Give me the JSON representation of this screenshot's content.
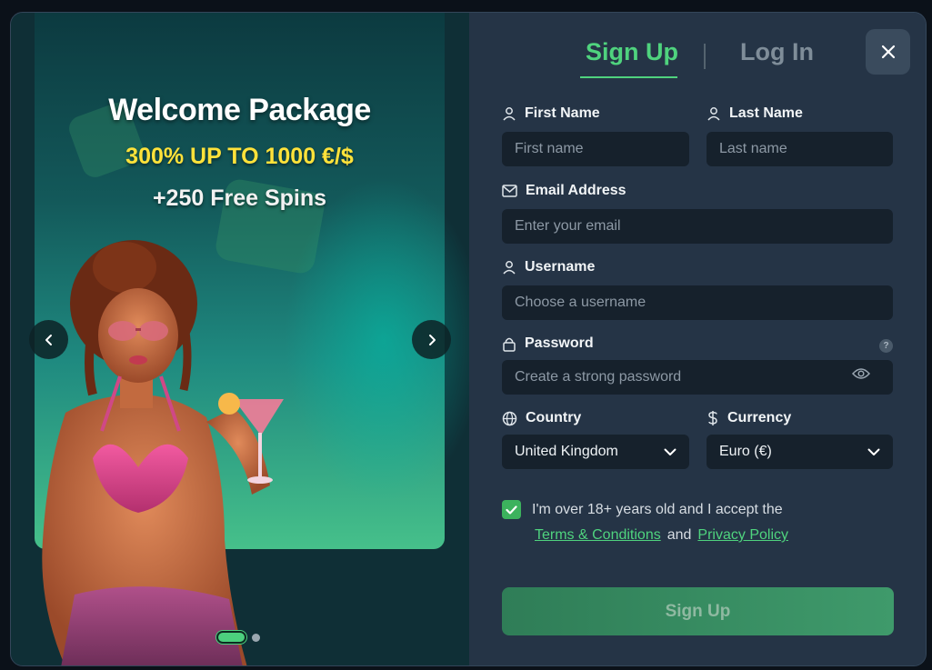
{
  "promo": {
    "title": "Welcome Package",
    "subtitle": "300% UP TO 1000 €/$",
    "spins": "+250 Free Spins",
    "slide_count": 2,
    "active_slide": 1
  },
  "tabs": {
    "signup": "Sign Up",
    "login": "Log In",
    "active": "signup"
  },
  "form": {
    "first_name": {
      "label": "First Name",
      "placeholder": "First name"
    },
    "last_name": {
      "label": "Last Name",
      "placeholder": "Last name"
    },
    "email": {
      "label": "Email Address",
      "placeholder": "Enter your email"
    },
    "username": {
      "label": "Username",
      "placeholder": "Choose a username"
    },
    "password": {
      "label": "Password",
      "placeholder": "Create a strong password",
      "help": "?"
    },
    "country": {
      "label": "Country",
      "value": "United Kingdom"
    },
    "currency": {
      "label": "Currency",
      "value": "Euro (€)"
    },
    "age_check": {
      "checked": true,
      "text": "I'm over 18+ years old and I accept the",
      "terms_link": "Terms & Conditions",
      "and": "and",
      "privacy_link": "Privacy Policy"
    },
    "submit": "Sign Up"
  },
  "colors": {
    "accent": "#4fd37e",
    "promo_yellow": "#ffe23a",
    "panel": "#253446",
    "input": "#16212c"
  },
  "icons": [
    "chevron-left-icon",
    "chevron-right-icon",
    "close-icon",
    "user-icon",
    "mail-icon",
    "lock-icon",
    "eye-icon",
    "globe-icon",
    "dollar-icon",
    "chevron-down-icon",
    "check-icon"
  ]
}
